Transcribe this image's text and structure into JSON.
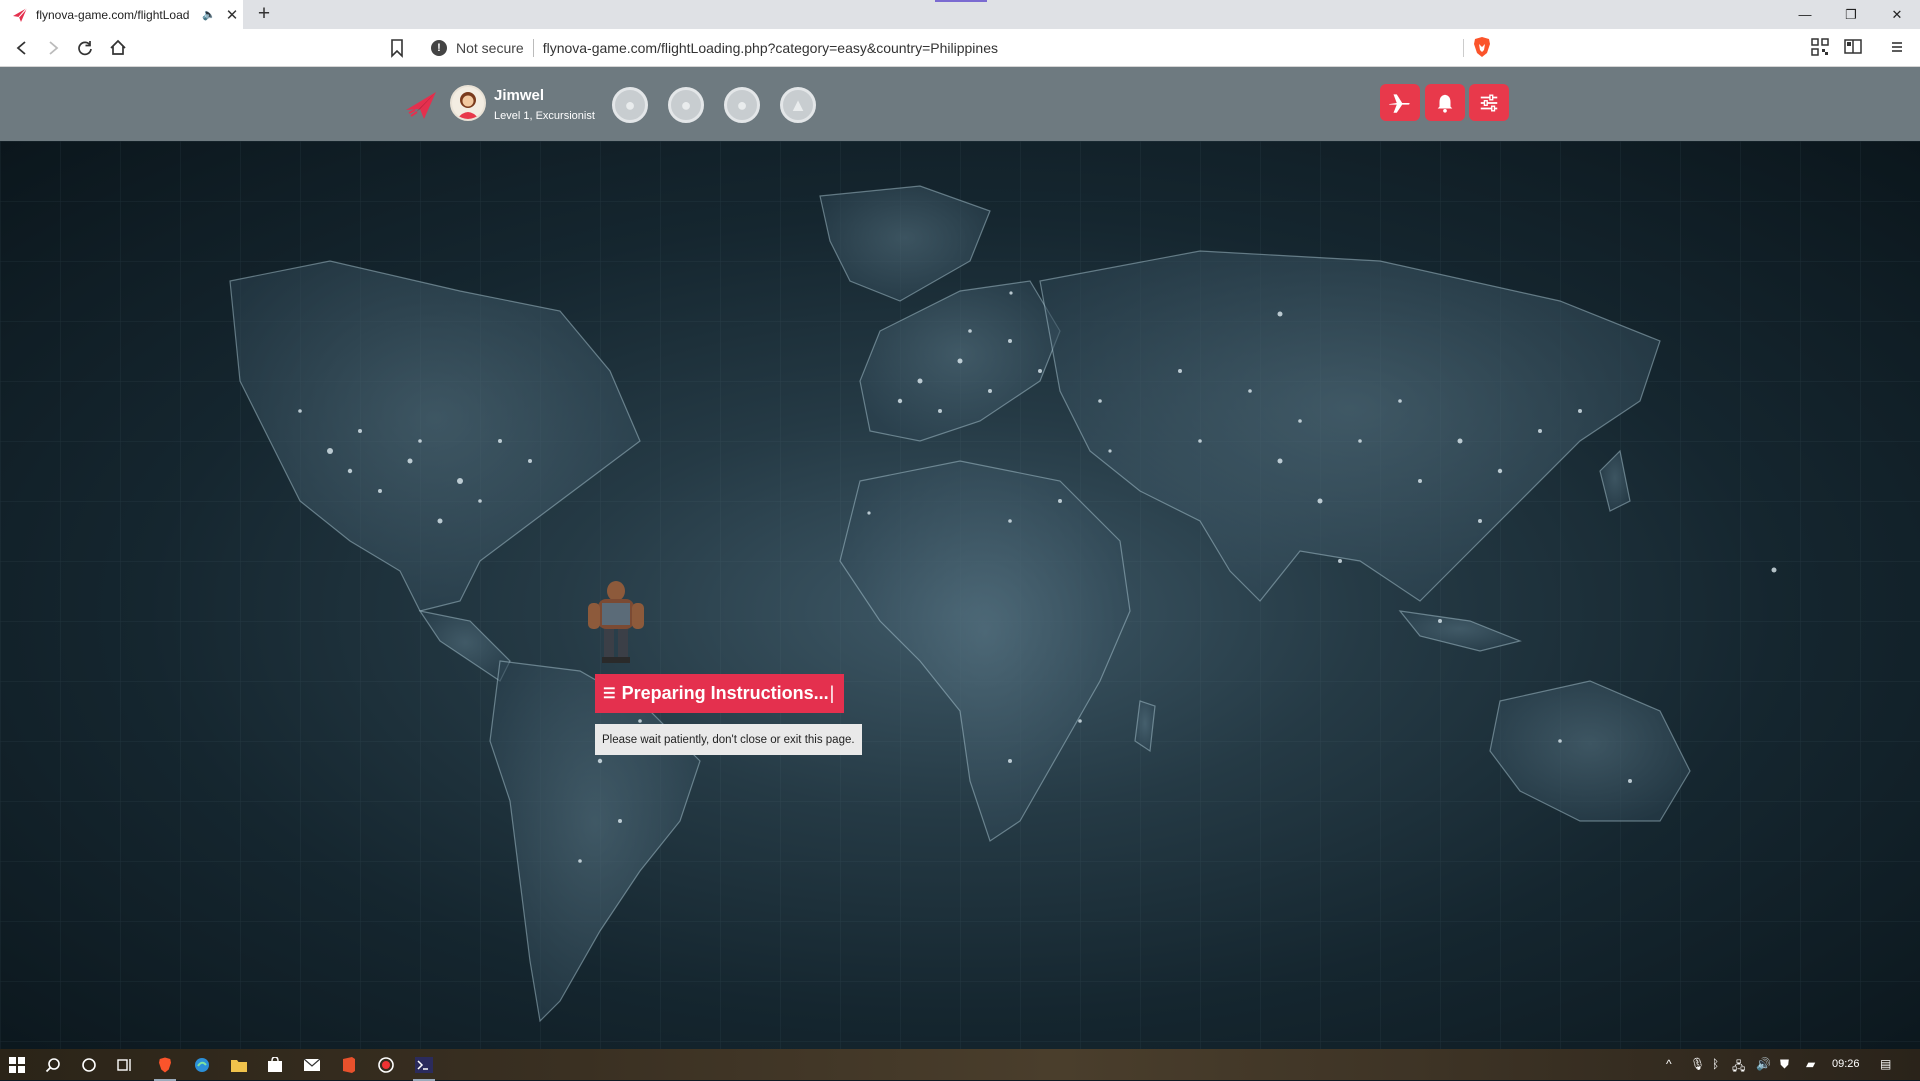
{
  "browser": {
    "tab_title": "flynova-game.com/flightLoad",
    "security_label": "Not secure",
    "url": "flynova-game.com/flightLoading.php?category=easy&country=Philippines"
  },
  "header": {
    "username": "Jimwel",
    "level": "Level 1, Excursionist",
    "badges": [
      "badge-1",
      "badge-2",
      "badge-3",
      "badge-4"
    ],
    "accent_color": "#e8394b",
    "buttons": [
      "plane-icon",
      "bell-icon",
      "settings-sliders-icon"
    ]
  },
  "loading": {
    "title": "Preparing Instructions...",
    "cursor": "|",
    "message": "Please wait patiently, don't close or exit this page."
  },
  "taskbar": {
    "clock": "09:26"
  }
}
